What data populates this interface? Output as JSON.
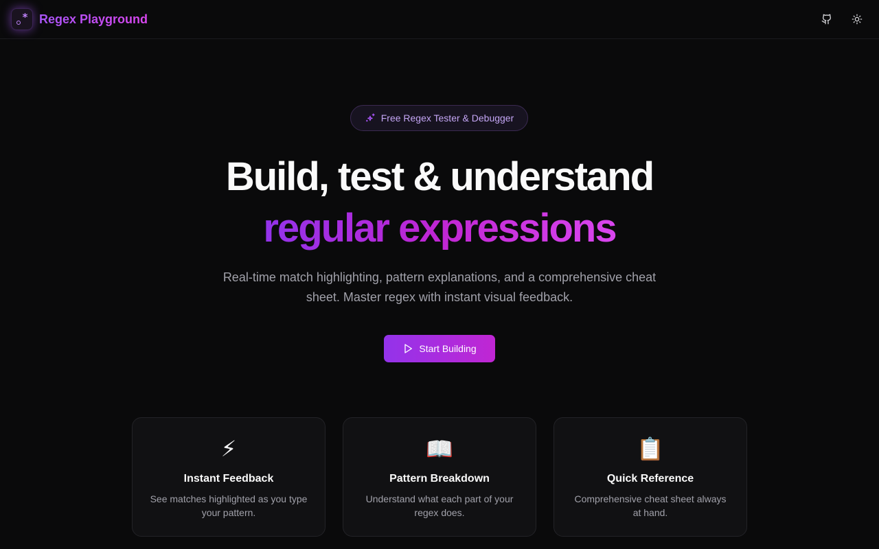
{
  "header": {
    "brand": "Regex Playground",
    "logo_glyph": "*",
    "actions": [
      {
        "icon": "github-icon"
      },
      {
        "icon": "sun-icon"
      }
    ]
  },
  "hero": {
    "badge": "Free Regex Tester & Debugger",
    "headline_line1": "Build, test & understand",
    "headline_line2": "regular expressions",
    "subtitle": "Real-time match highlighting, pattern explanations, and a comprehensive cheat sheet. Master regex with instant visual feedback.",
    "cta_label": "Start Building"
  },
  "features": [
    {
      "icon": "⚡",
      "title": "Instant Feedback",
      "desc": "See matches highlighted as you type your pattern."
    },
    {
      "icon": "📖",
      "title": "Pattern Breakdown",
      "desc": "Understand what each part of your regex does."
    },
    {
      "icon": "📋",
      "title": "Quick Reference",
      "desc": "Comprehensive cheat sheet always at hand."
    }
  ],
  "colors": {
    "background": "#0a0a0b",
    "accent_start": "#9333ea",
    "accent_end": "#d946ef",
    "muted_text": "#a1a1aa"
  }
}
